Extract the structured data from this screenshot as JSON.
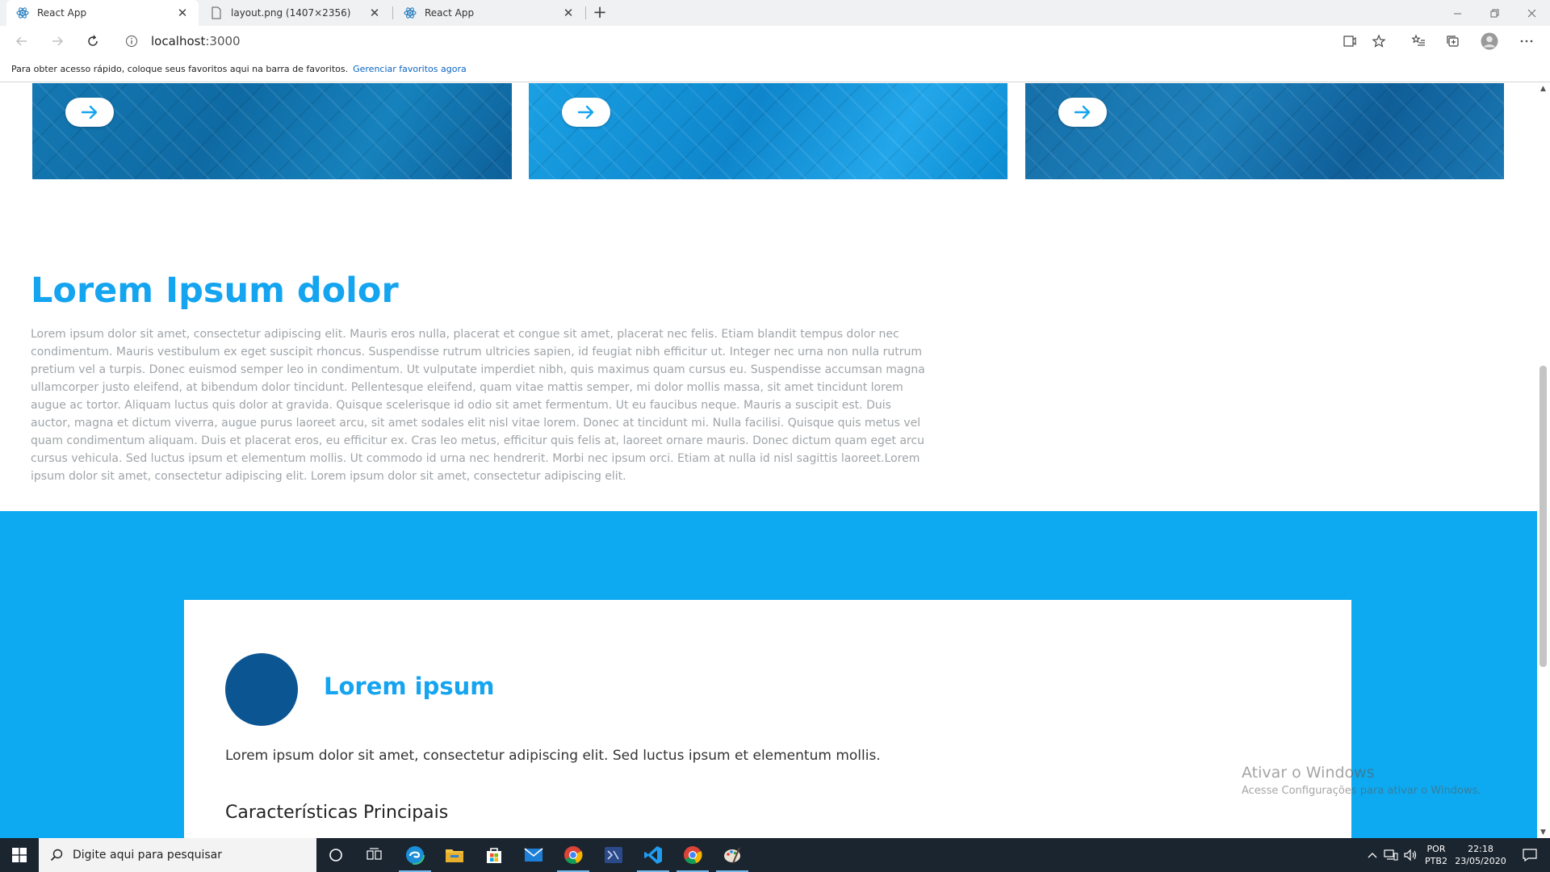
{
  "browser": {
    "tabs": [
      {
        "label": "React App",
        "active": true
      },
      {
        "label": "layout.png (1407×2356)",
        "active": false
      },
      {
        "label": "React App",
        "active": false
      }
    ],
    "address": {
      "host": "localhost",
      "port": ":3000"
    },
    "favorites_bar": {
      "text": "Para obter acesso rápido, coloque seus favoritos aqui na barra de favoritos.",
      "link": "Gerenciar favoritos agora"
    }
  },
  "page": {
    "section": {
      "title": "Lorem Ipsum dolor",
      "body": "Lorem ipsum dolor sit amet, consectetur adipiscing elit. Mauris eros nulla, placerat et congue sit amet, placerat nec felis. Etiam blandit tempus dolor nec condimentum. Mauris vestibulum ex eget suscipit rhoncus. Suspendisse rutrum ultricies sapien, id feugiat nibh efficitur ut. Integer nec urna non nulla rutrum pretium vel a turpis. Donec euismod semper leo in condimentum. Ut vulputate imperdiet nibh, quis maximus quam cursus eu. Suspendisse accumsan magna ullamcorper justo eleifend, at bibendum dolor tincidunt. Pellentesque eleifend, quam vitae mattis semper, mi dolor mollis massa, sit amet tincidunt lorem augue ac tortor. Aliquam luctus quis dolor at gravida. Quisque scelerisque id odio sit amet fermentum. Ut eu faucibus neque. Mauris a suscipit est. Duis auctor, magna et dictum viverra, augue purus laoreet arcu, sit amet sodales elit nisl vitae lorem. Donec at tincidunt mi. Nulla facilisi. Quisque quis metus vel quam condimentum aliquam. Duis et placerat eros, eu efficitur ex. Cras leo metus, efficitur quis felis at, laoreet ornare mauris. Donec dictum quam eget arcu cursus vehicula. Sed luctus ipsum et elementum mollis. Ut commodo id urna nec hendrerit. Morbi nec ipsum orci. Etiam at nulla id nisl sagittis laoreet.Lorem ipsum dolor sit amet, consectetur adipiscing elit. Lorem ipsum dolor sit amet, consectetur adipiscing elit."
    },
    "panel": {
      "title": "Lorem ipsum",
      "body": "Lorem ipsum dolor sit amet, consectetur adipiscing elit. Sed luctus ipsum et elementum mollis.",
      "subtitle": "Características Principais"
    },
    "colors": {
      "accent": "#14a4f0",
      "band": "#0daaf2",
      "avatar": "#0b5592"
    }
  },
  "watermark": {
    "line1": "Ativar o Windows",
    "line2": "Acesse Configurações para ativar o Windows."
  },
  "taskbar": {
    "search_placeholder": "Digite aqui para pesquisar",
    "apps": [
      "cortana-icon",
      "task-view-icon",
      "edge-icon",
      "file-explorer-icon",
      "store-icon",
      "mail-icon",
      "chrome-icon",
      "app-icon",
      "vscode-icon",
      "chrome-icon",
      "paint-icon"
    ],
    "language": {
      "line1": "POR",
      "line2": "PTB2"
    },
    "clock": {
      "time": "22:18",
      "date": "23/05/2020"
    }
  }
}
